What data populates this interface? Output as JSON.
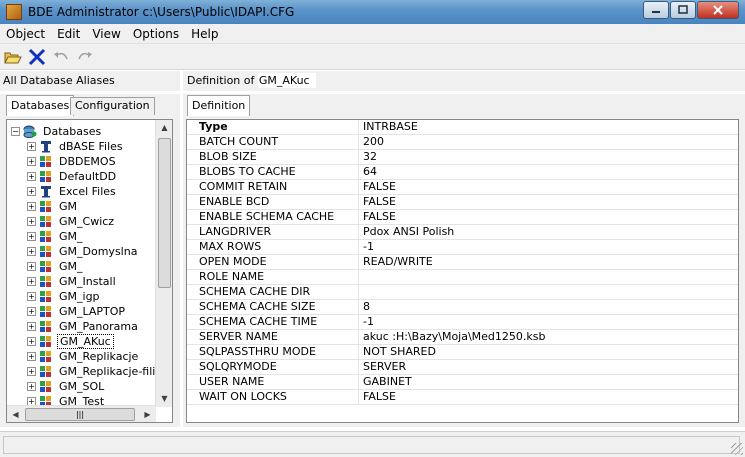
{
  "window": {
    "title": "BDE Administrator  c:\\Users\\Public\\IDAPI.CFG"
  },
  "menu": [
    {
      "label": "Object"
    },
    {
      "label": "Edit"
    },
    {
      "label": "View"
    },
    {
      "label": "Options"
    },
    {
      "label": "Help"
    }
  ],
  "left": {
    "header": "All Database Aliases",
    "tabs": [
      "Databases",
      "Configuration"
    ],
    "tree": {
      "root": "Databases",
      "items": [
        {
          "label": "dBASE Files",
          "icon": "table-icon"
        },
        {
          "label": "DBDEMOS",
          "icon": "database-icon"
        },
        {
          "label": "DefaultDD",
          "icon": "database-icon"
        },
        {
          "label": "Excel Files",
          "icon": "table-icon"
        },
        {
          "label": "GM",
          "icon": "database-icon"
        },
        {
          "label": "GM_Cwicz",
          "icon": "database-icon"
        },
        {
          "label": "GM_",
          "icon": "database-icon"
        },
        {
          "label": "GM_Domyslna",
          "icon": "database-icon"
        },
        {
          "label": "GM_",
          "icon": "database-icon"
        },
        {
          "label": "GM_Install",
          "icon": "database-icon"
        },
        {
          "label": "GM_igp",
          "icon": "database-icon"
        },
        {
          "label": "GM_LAPTOP",
          "icon": "database-icon"
        },
        {
          "label": "GM_Panorama",
          "icon": "database-icon"
        },
        {
          "label": "GM_AKuc",
          "icon": "database-icon",
          "selected": true
        },
        {
          "label": "GM_Replikacje",
          "icon": "database-icon"
        },
        {
          "label": "GM_Replikacje-filie",
          "icon": "database-icon"
        },
        {
          "label": "GM_SOL",
          "icon": "database-icon"
        },
        {
          "label": "GM_Test",
          "icon": "database-icon"
        }
      ]
    }
  },
  "right": {
    "header_prefix": "Definition of ",
    "alias": "GM_AKuc",
    "tab": "Definition",
    "rows": [
      {
        "name": "Type",
        "value": "INTRBASE",
        "header": true
      },
      {
        "name": "BATCH COUNT",
        "value": "200"
      },
      {
        "name": "BLOB SIZE",
        "value": "32"
      },
      {
        "name": "BLOBS TO CACHE",
        "value": "64"
      },
      {
        "name": "COMMIT RETAIN",
        "value": "FALSE"
      },
      {
        "name": "ENABLE BCD",
        "value": "FALSE"
      },
      {
        "name": "ENABLE SCHEMA CACHE",
        "value": "FALSE"
      },
      {
        "name": "LANGDRIVER",
        "value": "Pdox ANSI Polish"
      },
      {
        "name": "MAX ROWS",
        "value": "-1"
      },
      {
        "name": "OPEN MODE",
        "value": "READ/WRITE"
      },
      {
        "name": "ROLE NAME",
        "value": ""
      },
      {
        "name": "SCHEMA CACHE DIR",
        "value": ""
      },
      {
        "name": "SCHEMA CACHE SIZE",
        "value": "8"
      },
      {
        "name": "SCHEMA CACHE TIME",
        "value": "-1"
      },
      {
        "name": "SERVER NAME",
        "value": " akuc :H:\\Bazy\\Moja\\Med1250.ksb"
      },
      {
        "name": "SQLPASSTHRU MODE",
        "value": "NOT SHARED"
      },
      {
        "name": "SQLQRYMODE",
        "value": "SERVER"
      },
      {
        "name": "USER NAME",
        "value": "GABINET"
      },
      {
        "name": "WAIT ON LOCKS",
        "value": "FALSE"
      }
    ]
  },
  "colors": {
    "accent": "#1a3a9a",
    "delete": "#1030c0",
    "titlebar": "#5b93c9"
  }
}
